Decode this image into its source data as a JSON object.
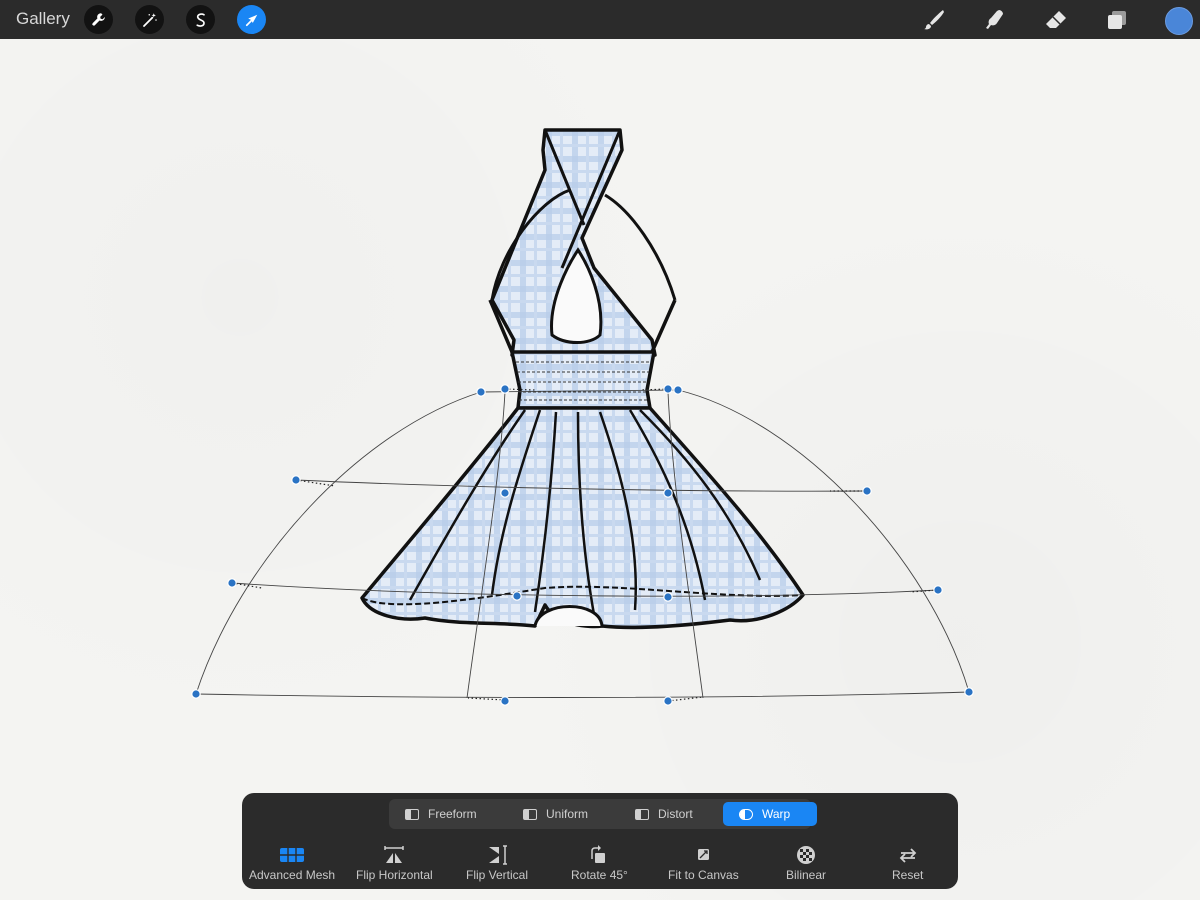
{
  "topbar": {
    "gallery_label": "Gallery",
    "left_tools": [
      {
        "name": "wrench-icon",
        "active": false
      },
      {
        "name": "magic-wand-icon",
        "active": false
      },
      {
        "name": "selection-icon",
        "active": false
      },
      {
        "name": "transform-arrow-icon",
        "active": true
      }
    ],
    "right_tools": [
      "brush-icon",
      "smudge-icon",
      "eraser-icon",
      "layers-icon"
    ],
    "current_color": "#4a86d8"
  },
  "transform": {
    "modes": [
      {
        "label": "Freeform",
        "active": false
      },
      {
        "label": "Uniform",
        "active": false
      },
      {
        "label": "Distort",
        "active": false
      },
      {
        "label": "Warp",
        "active": true
      }
    ],
    "actions": [
      {
        "label": "Advanced Mesh",
        "icon": "mesh-icon",
        "active": true
      },
      {
        "label": "Flip Horizontal",
        "icon": "flip-horizontal-icon",
        "active": false
      },
      {
        "label": "Flip Vertical",
        "icon": "flip-vertical-icon",
        "active": false
      },
      {
        "label": "Rotate 45°",
        "icon": "rotate-icon",
        "active": false
      },
      {
        "label": "Fit to Canvas",
        "icon": "fit-canvas-icon",
        "active": false
      },
      {
        "label": "Bilinear",
        "icon": "bilinear-icon",
        "active": false
      },
      {
        "label": "Reset",
        "icon": "reset-icon",
        "active": false
      }
    ]
  },
  "colors": {
    "accent": "#1a86f4",
    "handle": "#2a73c4",
    "fabric": "#c9d9ef"
  }
}
